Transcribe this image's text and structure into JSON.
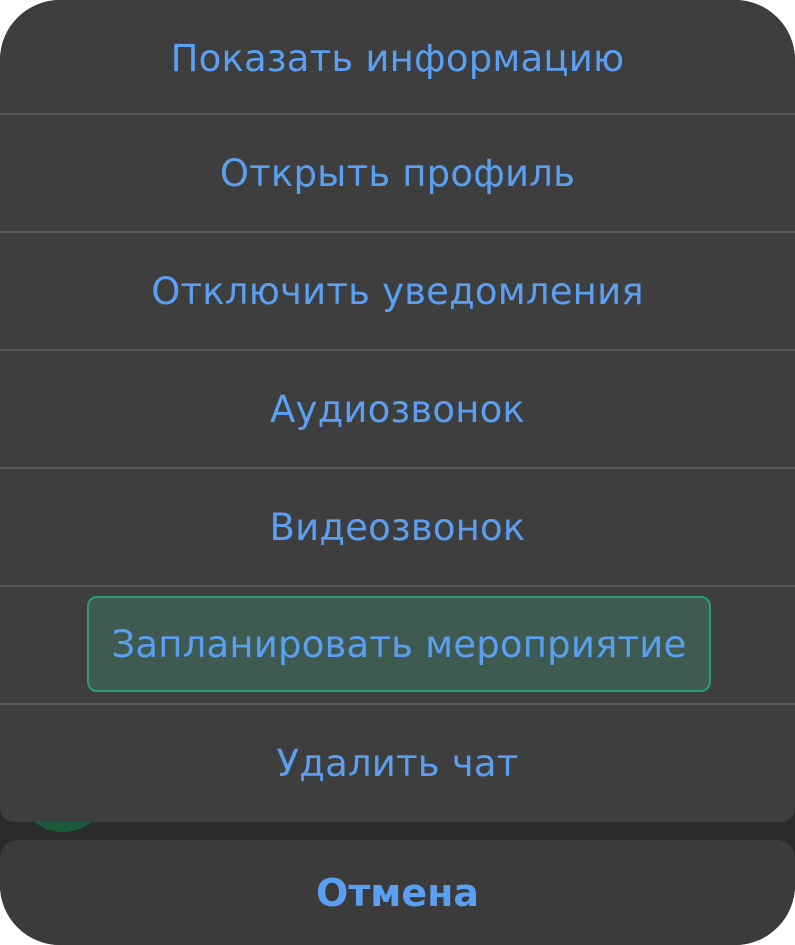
{
  "action_sheet": {
    "items": [
      {
        "label": "Показать информацию"
      },
      {
        "label": "Открыть профиль"
      },
      {
        "label": "Отключить уведомления"
      },
      {
        "label": "Аудиозвонок"
      },
      {
        "label": "Видеозвонок"
      },
      {
        "label": "Запланировать мероприятие",
        "highlighted": true
      },
      {
        "label": "Удалить чат"
      }
    ],
    "cancel_label": "Отмена"
  },
  "colors": {
    "action_text": "#5b9ff2",
    "sheet_background": "#3e3e3e",
    "highlight_border": "#2a9d72",
    "highlight_fill": "#3f5a50"
  }
}
